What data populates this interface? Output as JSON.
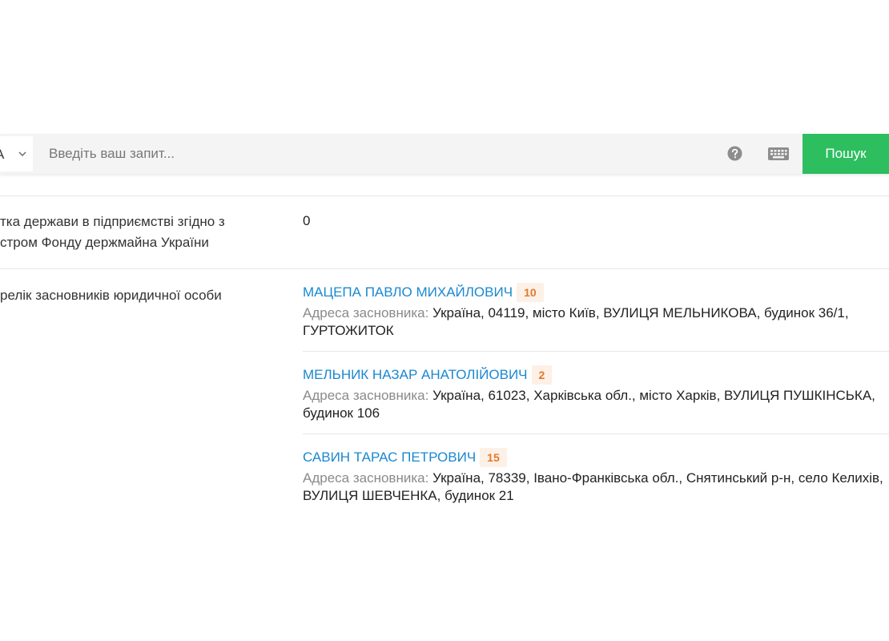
{
  "search": {
    "scope_label": "A",
    "placeholder": "Введіть ваш запит...",
    "button_label": "Пошук",
    "button_color": "#2dbe60"
  },
  "state_share": {
    "label_line1": "тка держави в підприємстві згідно з",
    "label_line2": "стром Фонду держмайна України",
    "value": "0"
  },
  "founders": {
    "label": "релік засновників юридичної особи",
    "address_label": "Адреса засновника:",
    "items": [
      {
        "name": "МАЦЕПА ПАВЛО МИХАЙЛОВИЧ",
        "count": "10",
        "address_line1": "Україна, 04119, місто Київ, ВУЛИЦЯ МЕЛЬНИКОВА, будинок 36/1,",
        "address_line2": "ГУРТОЖИТОК"
      },
      {
        "name": "МЕЛЬНИК НАЗАР АНАТОЛІЙОВИЧ",
        "count": "2",
        "address_line1": "Україна, 61023, Харківська обл., місто Харків, ВУЛИЦЯ ПУШКІНСЬКА,",
        "address_line2": "будинок 106"
      },
      {
        "name": "САВИН ТАРАС ПЕТРОВИЧ",
        "count": "15",
        "address_line1": "Україна, 78339, Івано-Франківська обл., Снятинський р-н, село Келихів,",
        "address_line2": "ВУЛИЦЯ ШЕВЧЕНКА, будинок 21"
      }
    ]
  },
  "colors": {
    "link": "#1a88d0",
    "badge_text": "#e07a2c",
    "badge_bg": "#fdf0e6"
  },
  "icons": {
    "help": "question-circle-icon",
    "keyboard": "keyboard-icon",
    "scope_dropdown": "chevron-down-icon"
  }
}
